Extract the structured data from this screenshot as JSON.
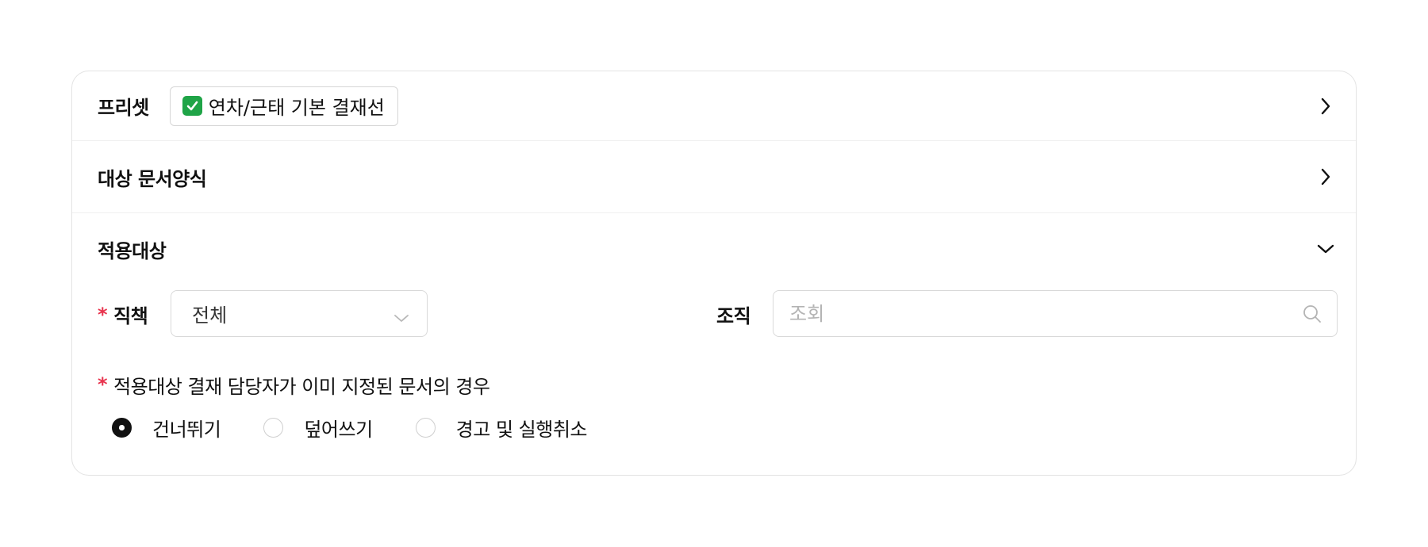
{
  "preset": {
    "title": "프리셋",
    "chip_emoji": "check-mark-button-emoji",
    "chip_label": "연차/근태 기본 결재선"
  },
  "doc_form": {
    "title": "대상 문서양식"
  },
  "apply_target": {
    "title": "적용대상",
    "position": {
      "label": "직책",
      "required_mark": "*",
      "value": "전체"
    },
    "organization": {
      "label": "조직",
      "placeholder": "조회"
    },
    "existing_approver": {
      "required_mark": "*",
      "question": "적용대상 결재 담당자가 이미 지정된 문서의 경우",
      "options": [
        {
          "label": "건너뛰기",
          "selected": true
        },
        {
          "label": "덮어쓰기",
          "selected": false
        },
        {
          "label": "경고 및 실행취소",
          "selected": false
        }
      ]
    }
  },
  "colors": {
    "required": "#e8344e",
    "border": "#d9d9d9",
    "text": "#111111",
    "placeholder": "#b4b4b4"
  }
}
